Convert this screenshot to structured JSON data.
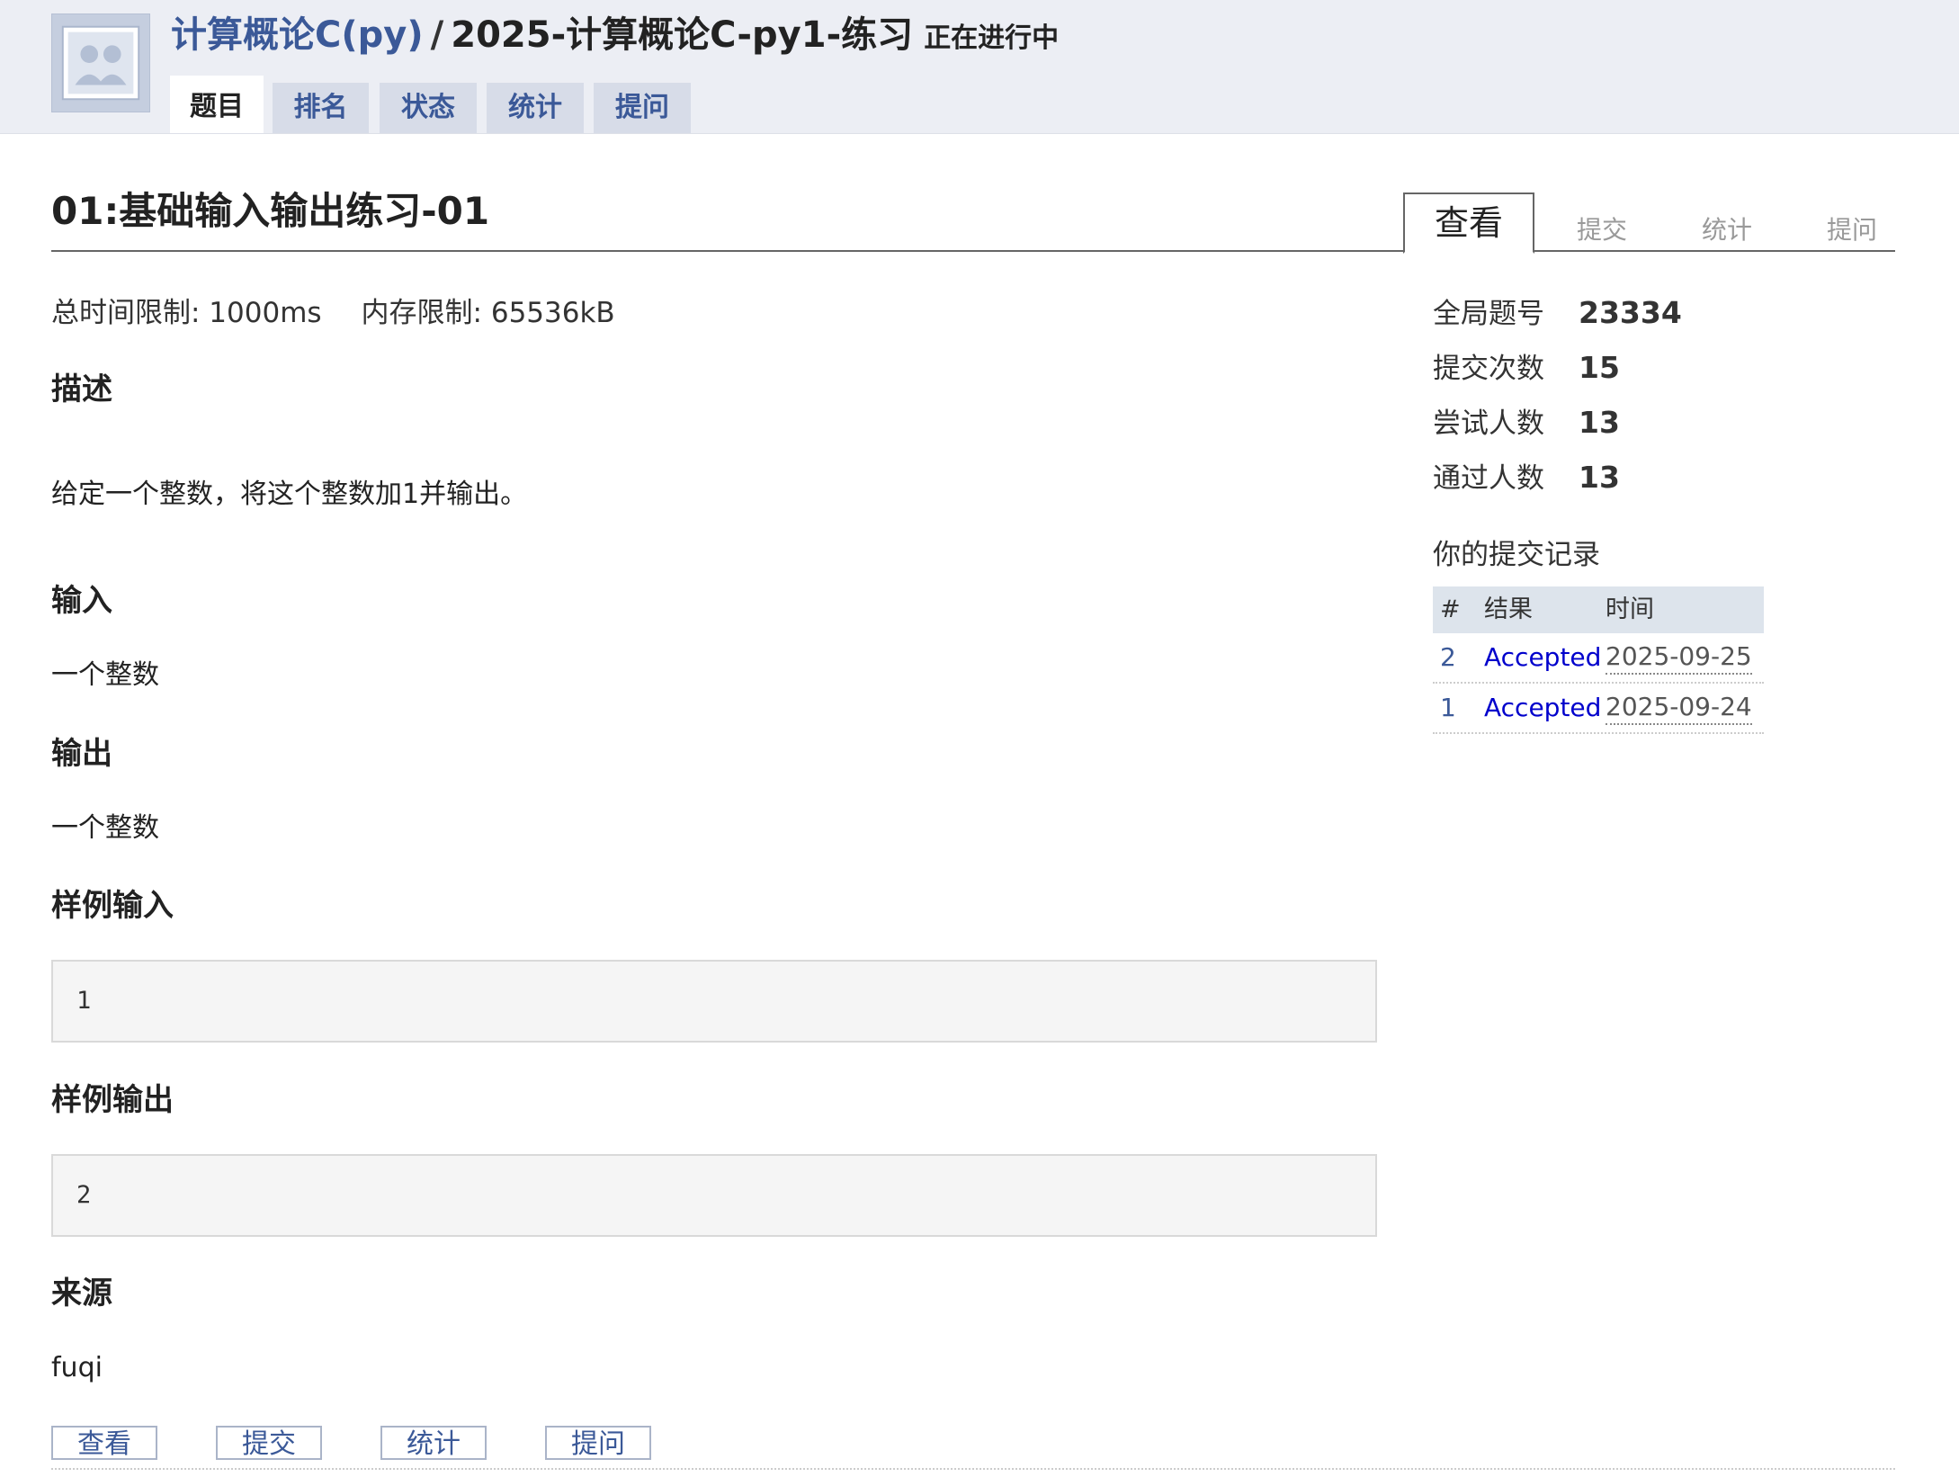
{
  "header": {
    "course": "计算概论C(py)",
    "separator": "/",
    "contest": "2025-计算概论C-py1-练习",
    "state": "正在进行中",
    "tabs": [
      "题目",
      "排名",
      "状态",
      "统计",
      "提问"
    ],
    "active_tab": "题目",
    "logo_icon": "group-avatar-icon"
  },
  "problem": {
    "title": "01:基础输入输出练习-01",
    "time_limit": "总时间限制: 1000ms",
    "memory_limit": "内存限制: 65536kB",
    "sections": {
      "description_heading": "描述",
      "description": "给定一个整数，将这个整数加1并输出。",
      "input_heading": "输入",
      "input": "一个整数",
      "output_heading": "输出",
      "output": "一个整数",
      "sample_input_heading": "样例输入",
      "sample_input": "1",
      "sample_output_heading": "样例输出",
      "sample_output": "2",
      "source_heading": "来源",
      "source": "fuqi"
    }
  },
  "side_tabs": [
    "查看",
    "提交",
    "统计",
    "提问"
  ],
  "stats": [
    {
      "label": "全局题号",
      "value": "23334"
    },
    {
      "label": "提交次数",
      "value": "15"
    },
    {
      "label": "尝试人数",
      "value": "13"
    },
    {
      "label": "通过人数",
      "value": "13"
    }
  ],
  "records": {
    "title": "你的提交记录",
    "headers": [
      "#",
      "结果",
      "时间"
    ],
    "rows": [
      {
        "num": "2",
        "result": "Accepted",
        "time": "2025-09-25"
      },
      {
        "num": "1",
        "result": "Accepted",
        "time": "2025-09-24"
      }
    ]
  },
  "bottom_links": [
    "查看",
    "提交",
    "统计",
    "提问"
  ],
  "colors": {
    "link": "#3b5998",
    "accepted": "#0000cc",
    "header_bg": "#eceef4"
  }
}
